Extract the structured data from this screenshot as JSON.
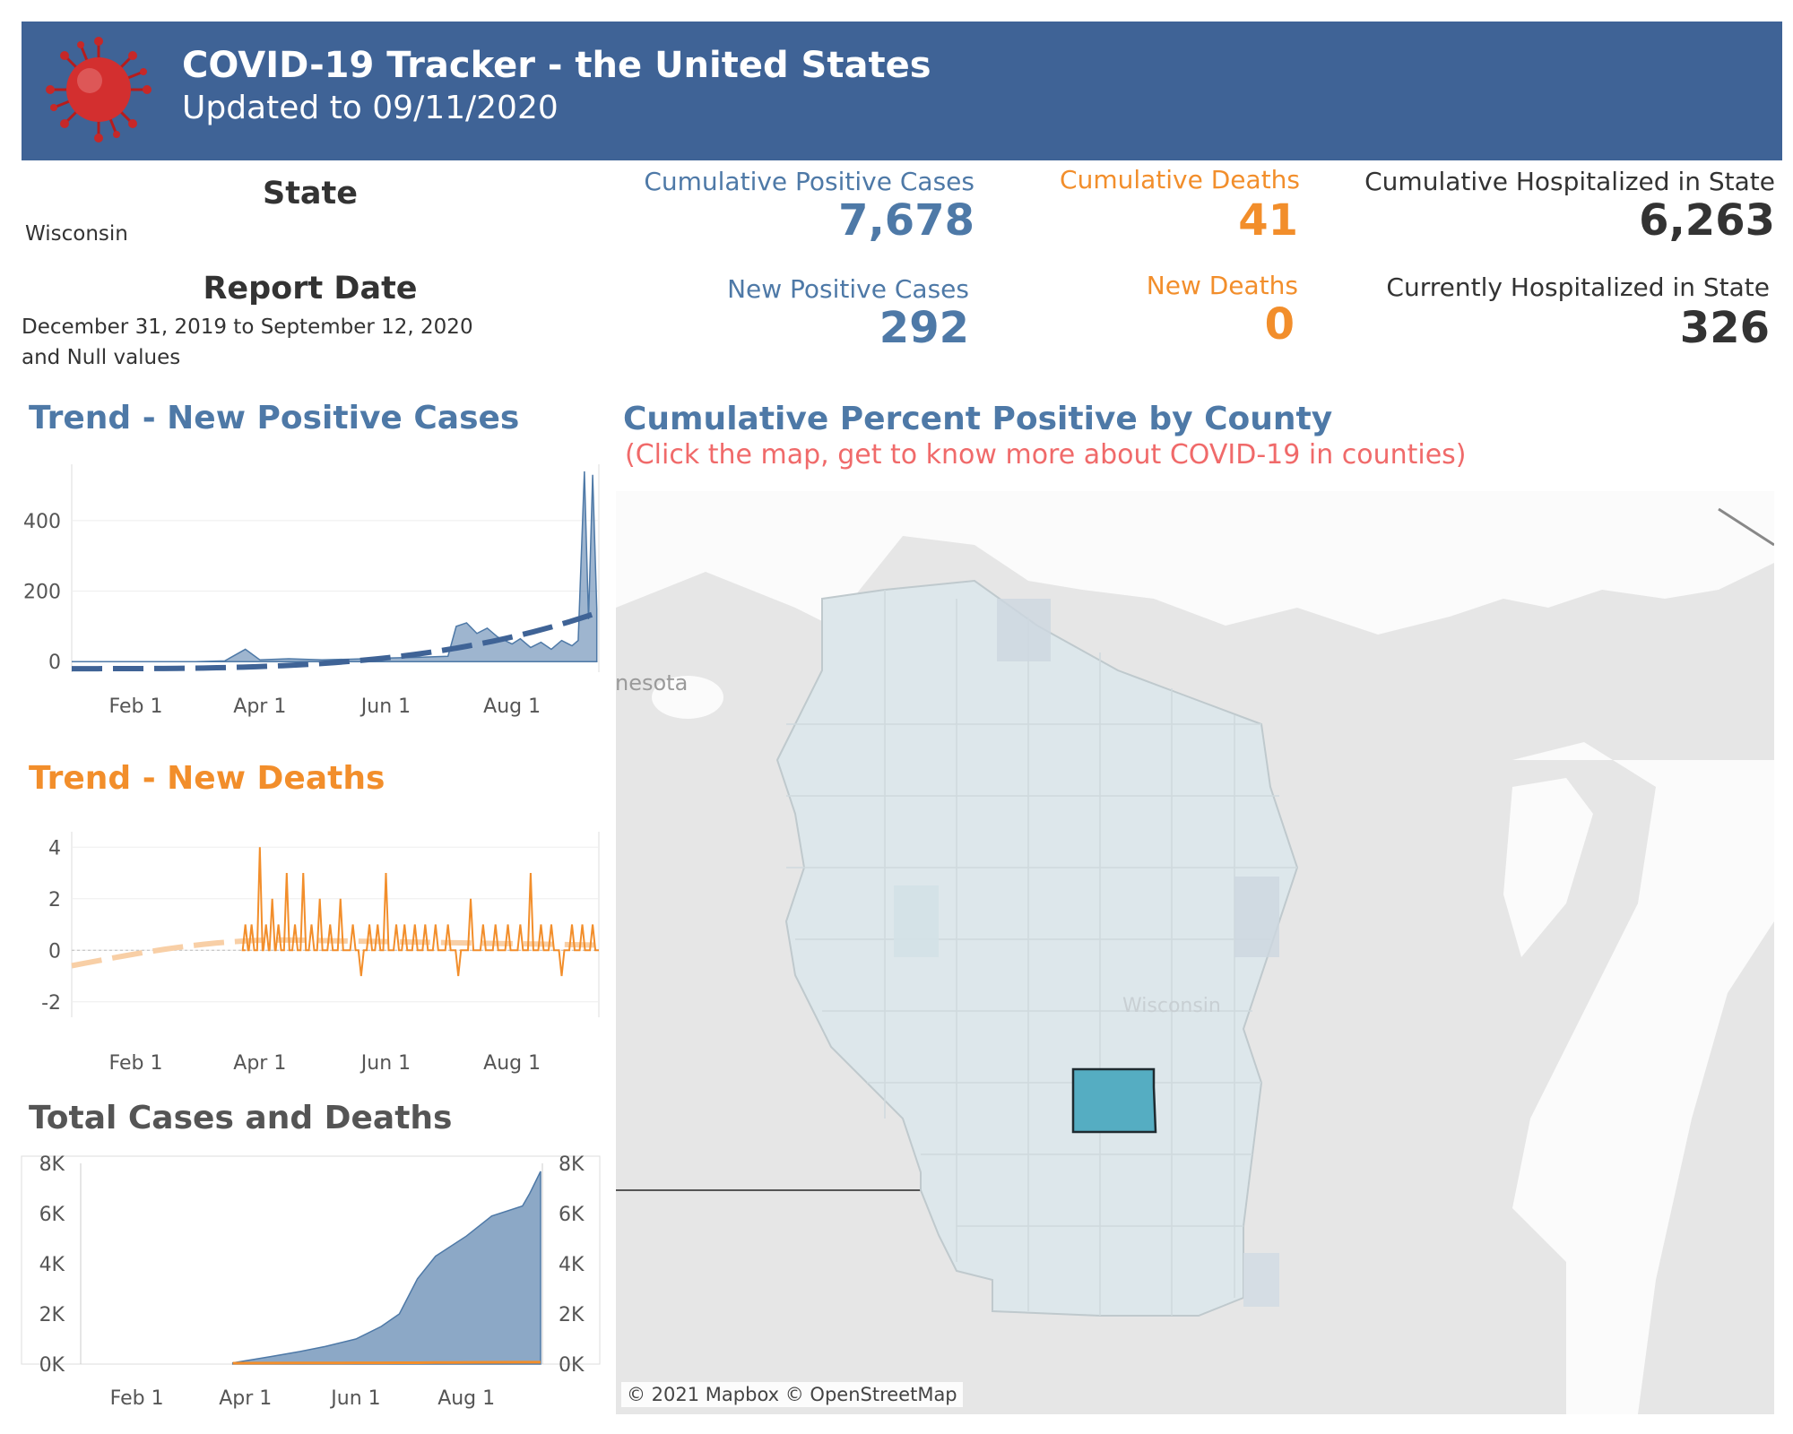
{
  "header": {
    "title": "COVID-19 Tracker - the United States",
    "subtitle": "Updated to 09/11/2020",
    "icon": "virus-icon",
    "background_color": "#3f6396"
  },
  "filters": {
    "state_label": "State",
    "state_value": "Wisconsin",
    "report_date_label": "Report Date",
    "report_date_line1": "December 31, 2019 to September 12, 2020",
    "report_date_line2": "and Null values"
  },
  "kpis": {
    "cumulative_positive_label": "Cumulative Positive Cases",
    "cumulative_positive_value": "7,678",
    "cumulative_deaths_label": "Cumulative Deaths",
    "cumulative_deaths_value": "41",
    "cumulative_hosp_label": "Cumulative Hospitalized in State",
    "cumulative_hosp_value": "6,263",
    "new_positive_label": "New Positive Cases",
    "new_positive_value": "292",
    "new_deaths_label": "New Deaths",
    "new_deaths_value": "0",
    "current_hosp_label": "Currently Hospitalized in State",
    "current_hosp_value": "326"
  },
  "colors": {
    "blue": "#4e79a7",
    "orange": "#f28e2b",
    "map_highlight": "#55adc2",
    "map_county": "#dde7eb"
  },
  "map": {
    "title": "Cumulative Percent Positive by County",
    "subtitle": "(Click the map, get to know more about COVID-19 in counties)",
    "state_label": "Wisconsin",
    "neighbor_label": "nesota",
    "credit": "© 2021 Mapbox © OpenStreetMap"
  },
  "chart_data": [
    {
      "id": "trend_new_cases",
      "title": "Trend - New Positive Cases",
      "type": "area",
      "x": [
        "2020-01-01",
        "2020-01-15",
        "2020-02-01",
        "2020-02-15",
        "2020-03-01",
        "2020-03-15",
        "2020-03-25",
        "2020-04-01",
        "2020-04-15",
        "2020-05-01",
        "2020-05-15",
        "2020-06-01",
        "2020-06-15",
        "2020-07-01",
        "2020-07-05",
        "2020-07-10",
        "2020-07-15",
        "2020-07-20",
        "2020-07-25",
        "2020-08-01",
        "2020-08-05",
        "2020-08-10",
        "2020-08-15",
        "2020-08-20",
        "2020-08-25",
        "2020-08-30",
        "2020-09-02",
        "2020-09-05",
        "2020-09-07",
        "2020-09-09",
        "2020-09-11"
      ],
      "values": [
        0,
        0,
        0,
        0,
        0,
        2,
        35,
        5,
        8,
        5,
        7,
        10,
        12,
        15,
        100,
        110,
        80,
        95,
        70,
        50,
        65,
        40,
        55,
        35,
        60,
        45,
        60,
        540,
        120,
        530,
        150
      ],
      "trend_line": {
        "start": -20,
        "end": 140
      },
      "xticks": [
        "Feb 1",
        "Apr 1",
        "Jun 1",
        "Aug 1"
      ],
      "yticks": [
        0,
        200,
        400
      ],
      "ylim": [
        -30,
        560
      ]
    },
    {
      "id": "trend_new_deaths",
      "title": "Trend - New Deaths",
      "type": "line",
      "x": [
        "2020-03-25",
        "2020-03-28",
        "2020-04-01",
        "2020-04-04",
        "2020-04-07",
        "2020-04-10",
        "2020-04-14",
        "2020-04-18",
        "2020-04-22",
        "2020-04-26",
        "2020-04-30",
        "2020-05-05",
        "2020-05-10",
        "2020-05-16",
        "2020-05-20",
        "2020-05-24",
        "2020-05-28",
        "2020-06-01",
        "2020-06-06",
        "2020-06-10",
        "2020-06-15",
        "2020-06-20",
        "2020-06-25",
        "2020-07-01",
        "2020-07-06",
        "2020-07-12",
        "2020-07-18",
        "2020-07-24",
        "2020-07-30",
        "2020-08-05",
        "2020-08-10",
        "2020-08-15",
        "2020-08-20",
        "2020-08-25",
        "2020-08-30",
        "2020-09-04",
        "2020-09-09"
      ],
      "values": [
        1,
        1,
        4,
        1,
        2,
        1,
        3,
        1,
        3,
        1,
        2,
        1,
        2,
        1,
        -1,
        1,
        1,
        3,
        1,
        1,
        1,
        1,
        1,
        1,
        -1,
        2,
        1,
        1,
        1,
        1,
        3,
        1,
        1,
        -1,
        1,
        1,
        1
      ],
      "trend_line": {
        "start": -0.6,
        "peak": 0.4,
        "end": 0.2
      },
      "xticks": [
        "Feb 1",
        "Apr 1",
        "Jun 1",
        "Aug 1"
      ],
      "yticks": [
        -2,
        0,
        2,
        4
      ],
      "ylim": [
        -2.6,
        4.6
      ]
    },
    {
      "id": "total_cases_deaths",
      "title": "Total Cases and Deaths",
      "type": "area",
      "x": [
        "2020-03-25",
        "2020-04-15",
        "2020-05-01",
        "2020-05-15",
        "2020-06-01",
        "2020-06-15",
        "2020-06-25",
        "2020-07-05",
        "2020-07-15",
        "2020-08-01",
        "2020-08-15",
        "2020-09-01",
        "2020-09-05",
        "2020-09-11"
      ],
      "series": [
        {
          "name": "Cumulative Positive Cases",
          "values": [
            50,
            300,
            500,
            700,
            1000,
            1500,
            2000,
            3400,
            4300,
            5100,
            5900,
            6300,
            6800,
            7678
          ]
        },
        {
          "name": "Cumulative Deaths",
          "values": [
            0,
            5,
            8,
            10,
            12,
            15,
            18,
            20,
            25,
            30,
            35,
            38,
            40,
            41
          ]
        }
      ],
      "xticks": [
        "Feb 1",
        "Apr 1",
        "Jun 1",
        "Aug 1"
      ],
      "yticks": [
        "0K",
        "2K",
        "4K",
        "6K",
        "8K"
      ],
      "ylim": [
        0,
        8000
      ]
    }
  ]
}
